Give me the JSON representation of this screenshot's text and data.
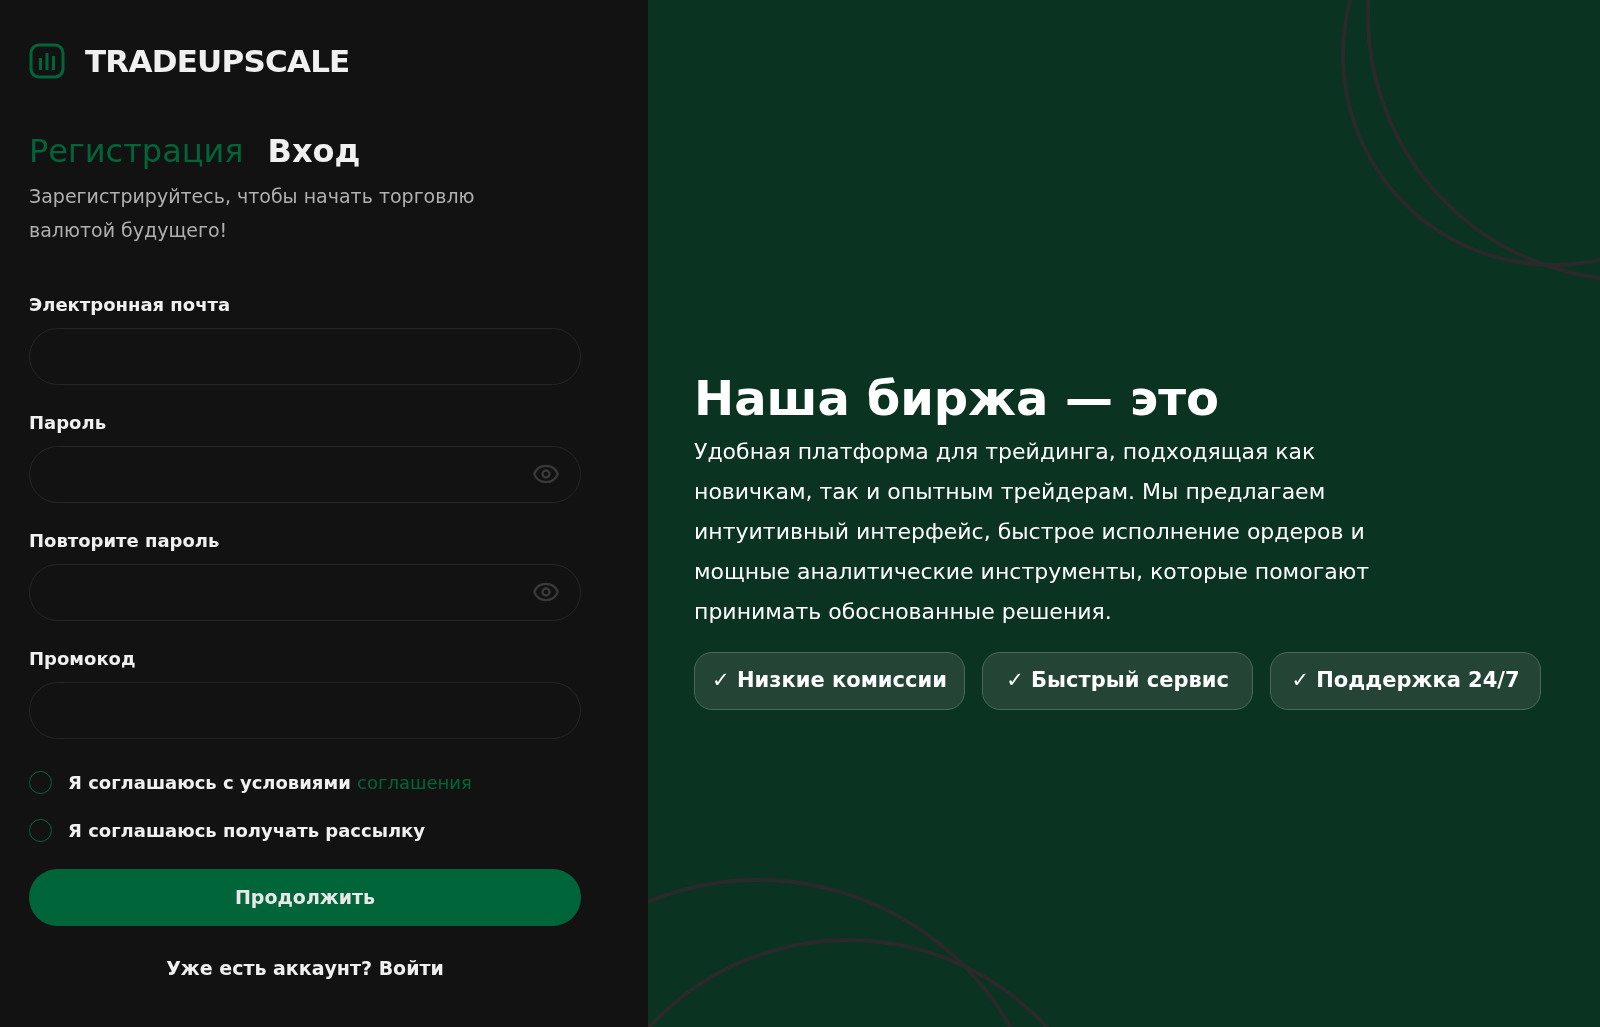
{
  "brand": {
    "name": "TRADEUPSCALE"
  },
  "tabs": [
    {
      "label": "Регистрация",
      "selected": true
    },
    {
      "label": "Вход",
      "selected": false
    }
  ],
  "subtitle": "Зарегистрируйтесь, чтобы начать торговлю валютой будущего!",
  "fields": [
    {
      "label": "Электронная почта",
      "kind": "text"
    },
    {
      "label": "Пароль",
      "kind": "password"
    },
    {
      "label": "Повторите пароль",
      "kind": "password"
    },
    {
      "label": "Промокод",
      "kind": "text"
    }
  ],
  "agreements": [
    {
      "text": "Я соглашаюсь с условиями",
      "link": "соглашения",
      "checked": false
    },
    {
      "text": "Я соглашаюсь получать рассылку",
      "checked": false
    }
  ],
  "submit": "Продолжить",
  "login_link": "Уже есть аккаунт? Войти",
  "promo": {
    "title": "Наша биржа — это",
    "text": "Удобная платформа для трейдинга, подходящая как новичкам, так и опытным трейдерам. Мы предлагаем интуитивный интерфейс, быстрое исполнение ордеров и мощные аналитические инструменты, которые помогают принимать обоснованные решения.",
    "features": [
      "✓ Низкие комиссии",
      "✓ Быстрый сервис",
      "✓ Поддержка 24/7"
    ]
  }
}
